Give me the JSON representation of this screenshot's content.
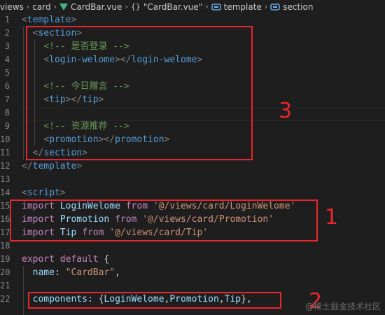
{
  "breadcrumb": {
    "items": [
      "views",
      "card",
      "CardBar.vue",
      "\"CardBar.vue\"",
      "template",
      "section"
    ],
    "icons": [
      "vue-file-icon",
      "braces-icon",
      "tag-icon",
      "tag-icon"
    ]
  },
  "editor": {
    "lines": [
      {
        "n": "1",
        "parts": [
          {
            "t": "<",
            "c": "tg"
          },
          {
            "t": "template",
            "c": "tn"
          },
          {
            "t": ">",
            "c": "tg"
          }
        ]
      },
      {
        "n": "2",
        "parts": [
          {
            "t": "  "
          },
          {
            "t": "<",
            "c": "tg"
          },
          {
            "t": "section",
            "c": "tn"
          },
          {
            "t": ">",
            "c": "tg"
          }
        ]
      },
      {
        "n": "3",
        "parts": [
          {
            "t": "    "
          },
          {
            "t": "<!-- 是否登录 -->",
            "c": "cm"
          }
        ]
      },
      {
        "n": "4",
        "parts": [
          {
            "t": "    "
          },
          {
            "t": "<",
            "c": "tg"
          },
          {
            "t": "login-welome",
            "c": "tn"
          },
          {
            "t": "></",
            "c": "tg"
          },
          {
            "t": "login-welome",
            "c": "tn"
          },
          {
            "t": ">",
            "c": "tg"
          }
        ]
      },
      {
        "n": "5",
        "parts": []
      },
      {
        "n": "6",
        "parts": [
          {
            "t": "    "
          },
          {
            "t": "<!-- 今日赠言 -->",
            "c": "cm"
          }
        ]
      },
      {
        "n": "7",
        "parts": [
          {
            "t": "    "
          },
          {
            "t": "<",
            "c": "tg"
          },
          {
            "t": "tip",
            "c": "tn"
          },
          {
            "t": "></",
            "c": "tg"
          },
          {
            "t": "tip",
            "c": "tn"
          },
          {
            "t": ">",
            "c": "tg"
          }
        ]
      },
      {
        "n": "8",
        "parts": []
      },
      {
        "n": "9",
        "parts": [
          {
            "t": "    "
          },
          {
            "t": "<!-- 资源推荐 -->",
            "c": "cm"
          }
        ]
      },
      {
        "n": "10",
        "parts": [
          {
            "t": "    "
          },
          {
            "t": "<",
            "c": "tg"
          },
          {
            "t": "promotion",
            "c": "tn"
          },
          {
            "t": "></",
            "c": "tg"
          },
          {
            "t": "promotion",
            "c": "tn"
          },
          {
            "t": ">",
            "c": "tg"
          }
        ]
      },
      {
        "n": "11",
        "parts": [
          {
            "t": "  "
          },
          {
            "t": "</",
            "c": "tg"
          },
          {
            "t": "section",
            "c": "tn"
          },
          {
            "t": ">",
            "c": "tg"
          }
        ]
      },
      {
        "n": "12",
        "parts": [
          {
            "t": "</",
            "c": "tg"
          },
          {
            "t": "template",
            "c": "tn"
          },
          {
            "t": ">",
            "c": "tg"
          }
        ]
      },
      {
        "n": "13",
        "parts": []
      },
      {
        "n": "14",
        "parts": [
          {
            "t": "<",
            "c": "tg"
          },
          {
            "t": "script",
            "c": "tn"
          },
          {
            "t": ">",
            "c": "tg"
          }
        ]
      },
      {
        "n": "15",
        "parts": [
          {
            "t": "import ",
            "c": "kw"
          },
          {
            "t": "LoginWelome",
            "c": "id"
          },
          {
            "t": " from ",
            "c": "kw"
          },
          {
            "t": "'@/views/card/LoginWelome'",
            "c": "st"
          }
        ]
      },
      {
        "n": "16",
        "parts": [
          {
            "t": "import ",
            "c": "kw"
          },
          {
            "t": "Promotion",
            "c": "id"
          },
          {
            "t": " from ",
            "c": "kw"
          },
          {
            "t": "'@/views/card/Promotion'",
            "c": "st"
          }
        ]
      },
      {
        "n": "17",
        "parts": [
          {
            "t": "import ",
            "c": "kw"
          },
          {
            "t": "Tip",
            "c": "id"
          },
          {
            "t": " from ",
            "c": "kw"
          },
          {
            "t": "'@/views/card/Tip'",
            "c": "st"
          }
        ]
      },
      {
        "n": "18",
        "parts": []
      },
      {
        "n": "19",
        "parts": [
          {
            "t": "export default ",
            "c": "kw"
          },
          {
            "t": "{",
            "c": "pl"
          }
        ]
      },
      {
        "n": "20",
        "parts": [
          {
            "t": "  "
          },
          {
            "t": "name",
            "c": "pr"
          },
          {
            "t": ": ",
            "c": "pl"
          },
          {
            "t": "\"CardBar\"",
            "c": "st"
          },
          {
            "t": ",",
            "c": "pl"
          }
        ]
      },
      {
        "n": "21",
        "parts": []
      },
      {
        "n": "22",
        "parts": [
          {
            "t": "  "
          },
          {
            "t": "components",
            "c": "pr"
          },
          {
            "t": ": {",
            "c": "pl"
          },
          {
            "t": "LoginWelome",
            "c": "id"
          },
          {
            "t": ",",
            "c": "pl"
          },
          {
            "t": "Promotion",
            "c": "id"
          },
          {
            "t": ",",
            "c": "pl"
          },
          {
            "t": "Tip",
            "c": "id"
          },
          {
            "t": "},",
            "c": "pl"
          }
        ]
      }
    ]
  },
  "annotations": {
    "box3_label": "3",
    "box1_label": "1",
    "box2_label": "2"
  },
  "watermark": "@稀土掘金技术社区",
  "colors": {
    "background": "#1e1e1e",
    "annotation_red": "#e8262b",
    "vue_green": "#41b883",
    "tag_blue": "#569cd6",
    "comment_green": "#6a9955",
    "keyword_purple": "#c586c0",
    "string_orange": "#ce9178"
  }
}
